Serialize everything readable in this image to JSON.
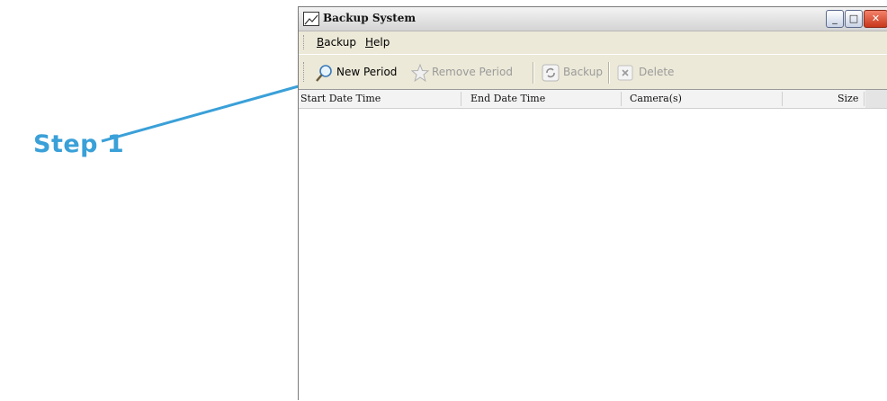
{
  "annotation": {
    "step_label": "Step 1",
    "color": "#3aa0d8"
  },
  "window": {
    "title": "Backup System",
    "controls": {
      "minimize_icon": "minimize-icon",
      "maximize_icon": "maximize-icon",
      "close_icon": "close-icon"
    }
  },
  "menu": {
    "items": [
      {
        "label_first": "B",
        "label_rest": "ackup"
      },
      {
        "label_first": "H",
        "label_rest": "elp"
      }
    ]
  },
  "toolbar": {
    "new_period": "New Period",
    "remove_period": "Remove Period",
    "backup": "Backup",
    "delete": "Delete"
  },
  "list": {
    "columns": [
      "Start Date Time",
      "End Date Time",
      "Camera(s)",
      "Size"
    ],
    "rows": []
  }
}
